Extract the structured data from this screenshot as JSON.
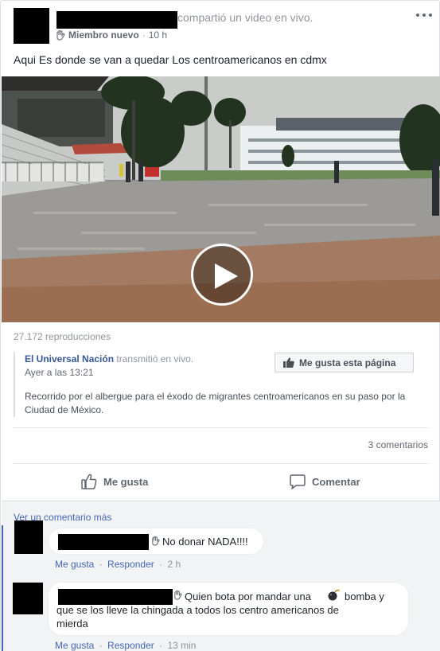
{
  "post": {
    "shared_action": "compartió",
    "shared_link": "un video en vivo.",
    "badge_label": "Miembro nuevo",
    "time": "10 h",
    "text": "Aqui Es donde se van a quedar Los centroamericanos en cdmx"
  },
  "video": {
    "views": "27.172 reproducciones"
  },
  "shared_page": {
    "name": "El Universal Nación",
    "action": "transmitió en vivo.",
    "time": "Ayer a las 13:21",
    "like_button": "Me gusta esta página",
    "description": "Recorrido por el albergue para el éxodo de migrantes centroamericanos en su paso por la Ciudad de México."
  },
  "engagement": {
    "comment_count": "3 comentarios",
    "like_label": "Me gusta",
    "comment_label": "Comentar"
  },
  "comments": {
    "more_link": "Ver un comentario más",
    "items": [
      {
        "text": "No donar NADA!!!!",
        "like": "Me gusta",
        "reply": "Responder",
        "time": "2 h"
      },
      {
        "text_before": "Quien bota por mandar una",
        "text_line1_end": "bomba y",
        "text_line2": "que se los lleve la chingada a todos los centro americanos de",
        "text_line3": "mierda",
        "like": "Me gusta",
        "reply": "Responder",
        "time": "13 min"
      }
    ]
  },
  "colors": {
    "link_blue": "#4267b2",
    "page_blue": "#365899",
    "meta_gray": "#90949c",
    "text_dark": "#1d2129"
  },
  "icons": {
    "wave": "waving-hand-icon",
    "more": "more-options-icon",
    "play": "play-icon",
    "thumbs_up": "thumbs-up-icon",
    "comment": "comment-bubble-icon",
    "bomb": "bomb-emoji-icon"
  }
}
